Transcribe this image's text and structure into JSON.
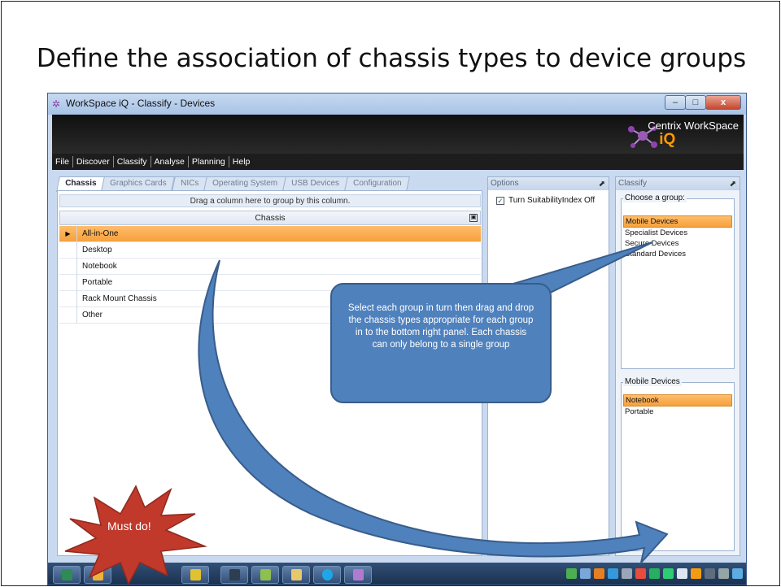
{
  "slide": {
    "title": "Define the association of chassis types to device groups"
  },
  "window": {
    "title": "WorkSpace iQ - Classify - Devices",
    "controls": {
      "minimize": "–",
      "maximize": "□",
      "close": "x"
    },
    "brand": {
      "name": "Centrix WorkSpace",
      "suffix": "iQ"
    }
  },
  "menu": [
    "File",
    "Discover",
    "Classify",
    "Analyse",
    "Planning",
    "Help"
  ],
  "tabs": [
    {
      "label": "Chassis",
      "active": true
    },
    {
      "label": "Graphics Cards"
    },
    {
      "label": "NICs"
    },
    {
      "label": "Operating System"
    },
    {
      "label": "USB Devices"
    },
    {
      "label": "Configuration"
    }
  ],
  "grid": {
    "group_hint": "Drag a column here to group by this column.",
    "column": "Chassis",
    "column_button": "▣",
    "row_indicator": "▶",
    "rows": [
      {
        "name": "All-in-One",
        "selected": true
      },
      {
        "name": "Desktop"
      },
      {
        "name": "Notebook"
      },
      {
        "name": "Portable"
      },
      {
        "name": "Rack Mount Chassis"
      },
      {
        "name": "Other"
      }
    ]
  },
  "options": {
    "title": "Options",
    "pin": "⬈",
    "check_mark": "✓",
    "items": [
      {
        "label": "Turn SuitabilityIndex Off",
        "checked": true
      }
    ]
  },
  "classify": {
    "title": "Classify",
    "pin": "⬈",
    "group_legend": "Choose a group:",
    "groups": [
      "Mobile Devices",
      "Specialist Devices",
      "Secure Devices",
      "Standard Devices"
    ],
    "selected_group": "Mobile Devices",
    "members_legend": "Mobile Devices",
    "members": [
      "Notebook",
      "Portable"
    ],
    "selected_member": "Notebook"
  },
  "callout": {
    "text": "Select each group in turn then  drag and drop the chassis types appropriate for  each group in to the bottom right panel.  Each chassis can only belong to a single group"
  },
  "burst": {
    "text": "Must do!"
  },
  "colors": {
    "selection": "#f6a03c",
    "callout": "#4f81bd",
    "burst": "#c0392b",
    "brand_accent": "#ff9a00"
  }
}
